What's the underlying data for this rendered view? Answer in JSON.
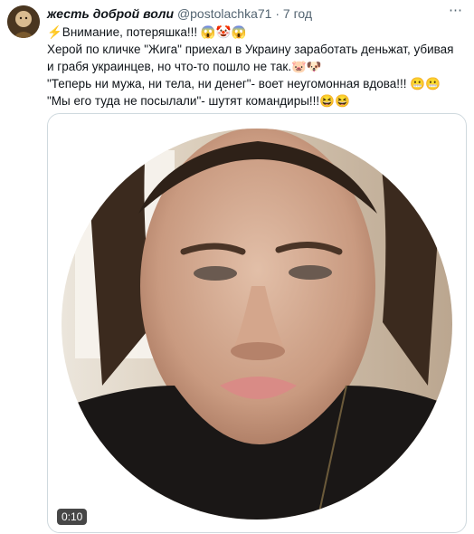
{
  "tweet": {
    "author_name": "жесть доброй воли",
    "handle": "@postolachka71",
    "separator": "·",
    "time": "7 год",
    "more_icon": "⋯",
    "lines": [
      "⚡Внимание, потеряшка!!! 😱🤡😱",
      " Херой по кличке \"Жига\" приехал в Украину заработать деньжат, убивая",
      "и грабя украинцев, но что-то пошло не так.🐷🐶",
      " \"Теперь ни мужа, ни тела, ни денег\"- воет неугомонная вдова!!! 😬😬",
      "\"Мы его туда не посылали\"- шутят командиры!!!😆😆"
    ],
    "video": {
      "duration": "0:10"
    }
  },
  "colors": {
    "text": "#0f1419",
    "muted": "#536471",
    "border": "#cfd9de"
  }
}
